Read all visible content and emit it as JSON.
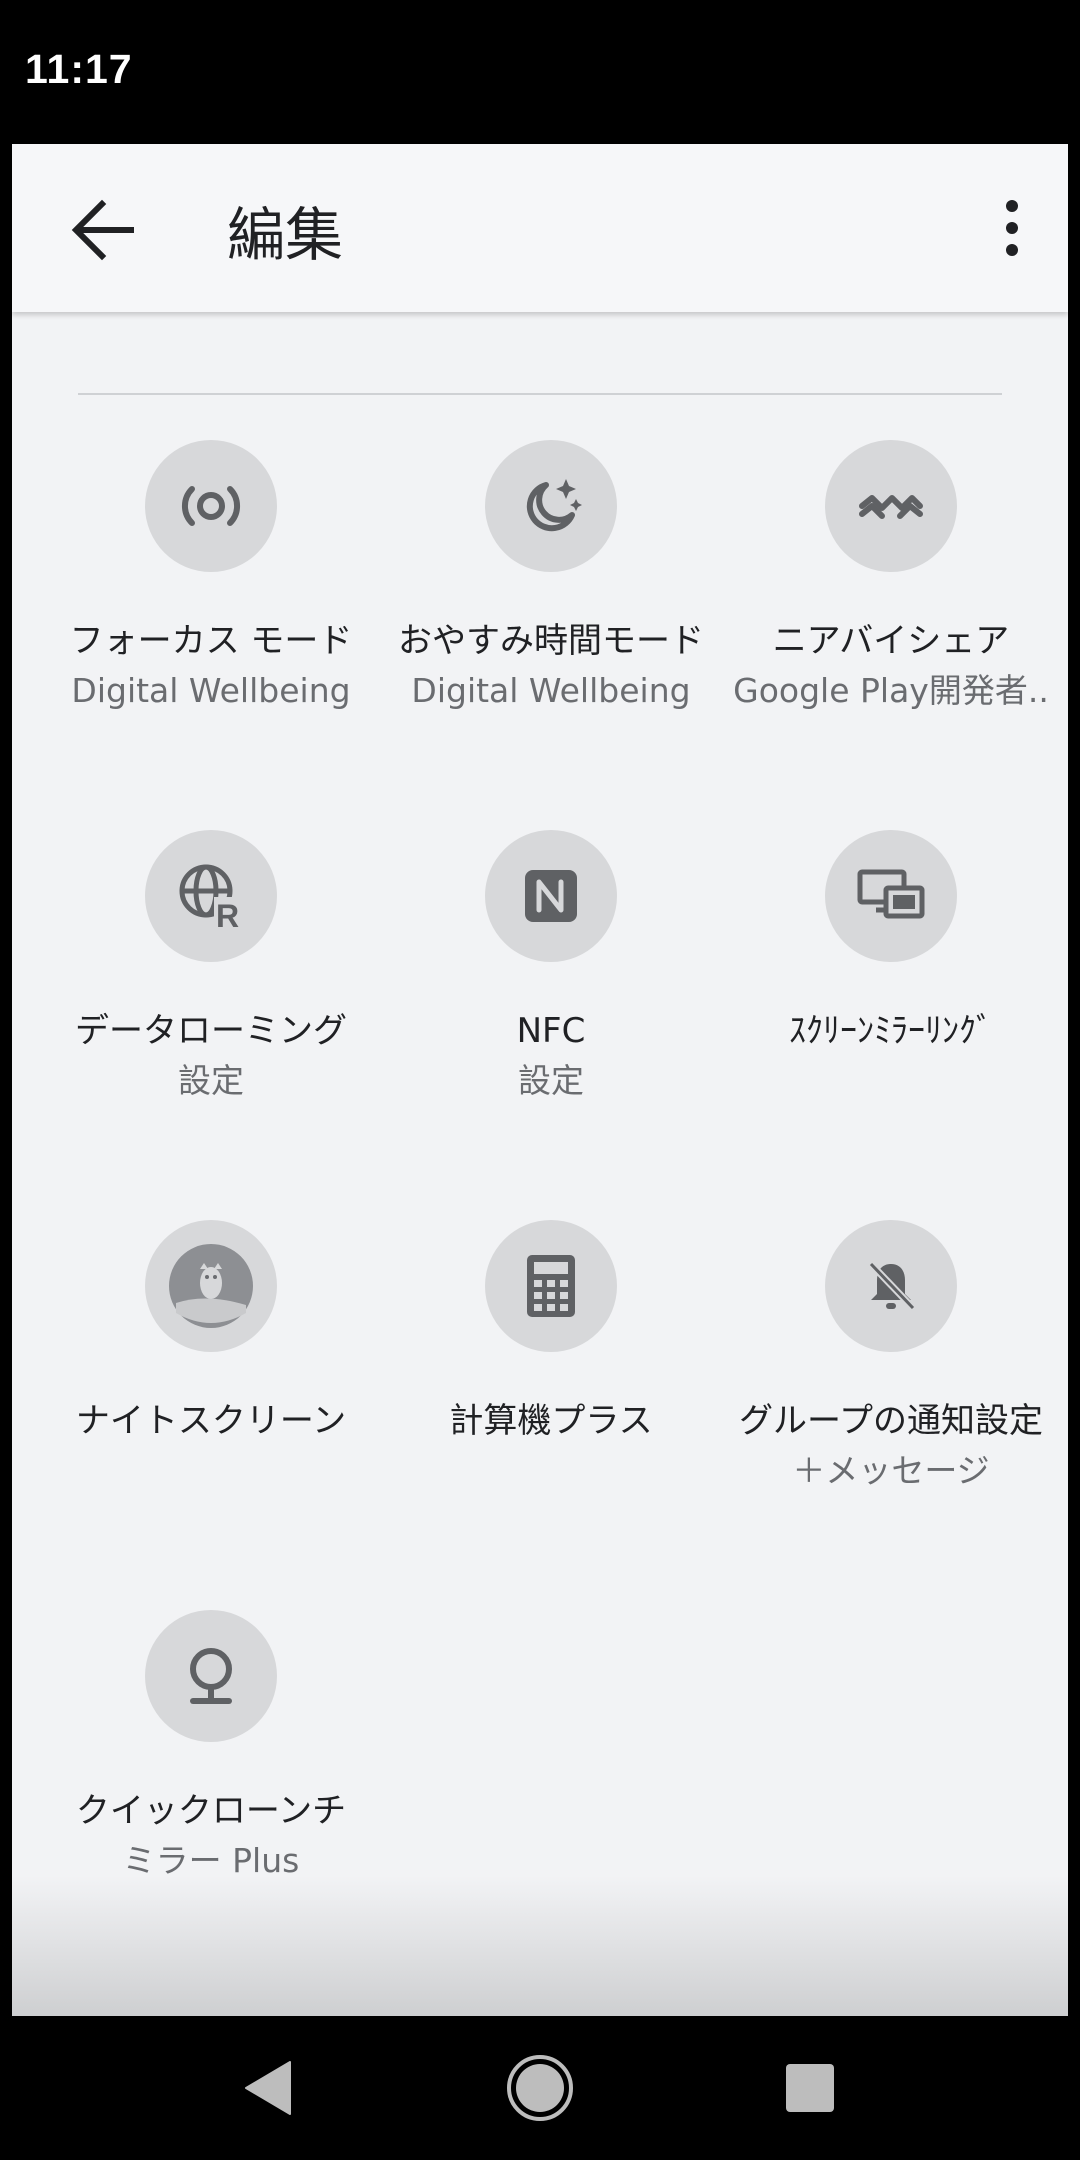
{
  "status_bar": {
    "time": "11:17"
  },
  "app_bar": {
    "title": "編集",
    "back_icon": "arrow-left-icon",
    "menu_icon": "more-vert-icon"
  },
  "tiles": [
    {
      "label": "フォーカス モード",
      "sub": "Digital Wellbeing",
      "icon": "focus-mode-icon"
    },
    {
      "label": "おやすみ時間モード",
      "sub": "Digital Wellbeing",
      "icon": "bedtime-moon-icon"
    },
    {
      "label": "ニアバイシェア",
      "sub": "Google Play開発者..",
      "icon": "nearby-share-icon"
    },
    {
      "label": "データローミング",
      "sub": "設定",
      "icon": "data-roaming-globe-icon"
    },
    {
      "label": "NFC",
      "sub": "設定",
      "icon": "nfc-icon"
    },
    {
      "label": "ｽｸﾘｰﾝﾐﾗｰﾘﾝｸﾞ",
      "sub": "",
      "icon": "screen-mirroring-icon"
    },
    {
      "label": "ナイトスクリーン",
      "sub": "",
      "icon": "night-screen-owl-icon"
    },
    {
      "label": "計算機プラス",
      "sub": "",
      "icon": "calculator-icon"
    },
    {
      "label": "グループの通知設定",
      "sub": "＋メッセージ",
      "icon": "notifications-off-icon"
    },
    {
      "label": "クイックローンチ",
      "sub": "ミラー Plus",
      "icon": "mirror-icon"
    }
  ],
  "nav_bar": {
    "back": "nav-back-icon",
    "home": "nav-home-icon",
    "recents": "nav-recents-icon"
  },
  "colors": {
    "icon_bg": "#d7d8da",
    "icon_fg": "#5f6164",
    "panel_bg": "#f2f3f5",
    "app_bar_bg": "#f6f7f9"
  }
}
